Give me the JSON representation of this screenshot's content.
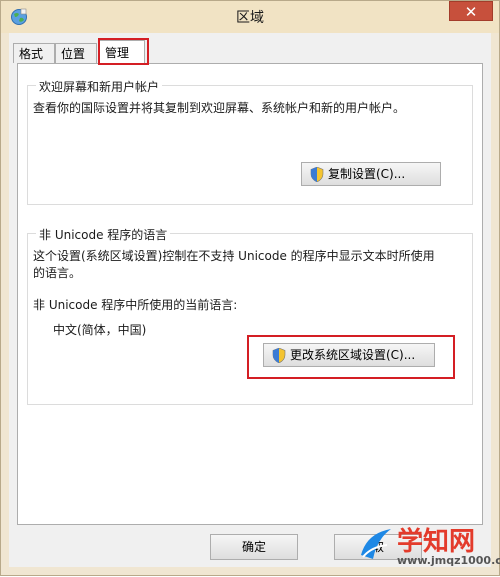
{
  "window": {
    "title": "区域",
    "close_glyph": "✕"
  },
  "tabs": [
    {
      "label": "格式",
      "selected": false
    },
    {
      "label": "位置",
      "selected": false
    },
    {
      "label": "管理",
      "selected": true
    }
  ],
  "welcome": {
    "title": "欢迎屏幕和新用户帐户",
    "description": "查看你的国际设置并将其复制到欢迎屏幕、系统帐户和新的用户帐户。",
    "copy_button": "复制设置(C)..."
  },
  "non_unicode": {
    "title": "非 Unicode 程序的语言",
    "description_line1": "这个设置(系统区域设置)控制在不支持 Unicode 的程序中显示文本时所使用",
    "description_line2": "的语言。",
    "current_label": "非 Unicode 程序中所使用的当前语言:",
    "current_value": "中文(简体，中国)",
    "change_button": "更改系统区域设置(C)..."
  },
  "footer": {
    "ok": "确定",
    "cancel": "取"
  },
  "watermark": {
    "brand": "学知网",
    "url": "www.jmqz1000.com"
  },
  "colors": {
    "highlight": "#d41e24",
    "titlebar": "#f1e3c4",
    "close": "#c7503c"
  },
  "icons": {
    "app": "globe-icon",
    "shield": "uac-shield-icon"
  }
}
